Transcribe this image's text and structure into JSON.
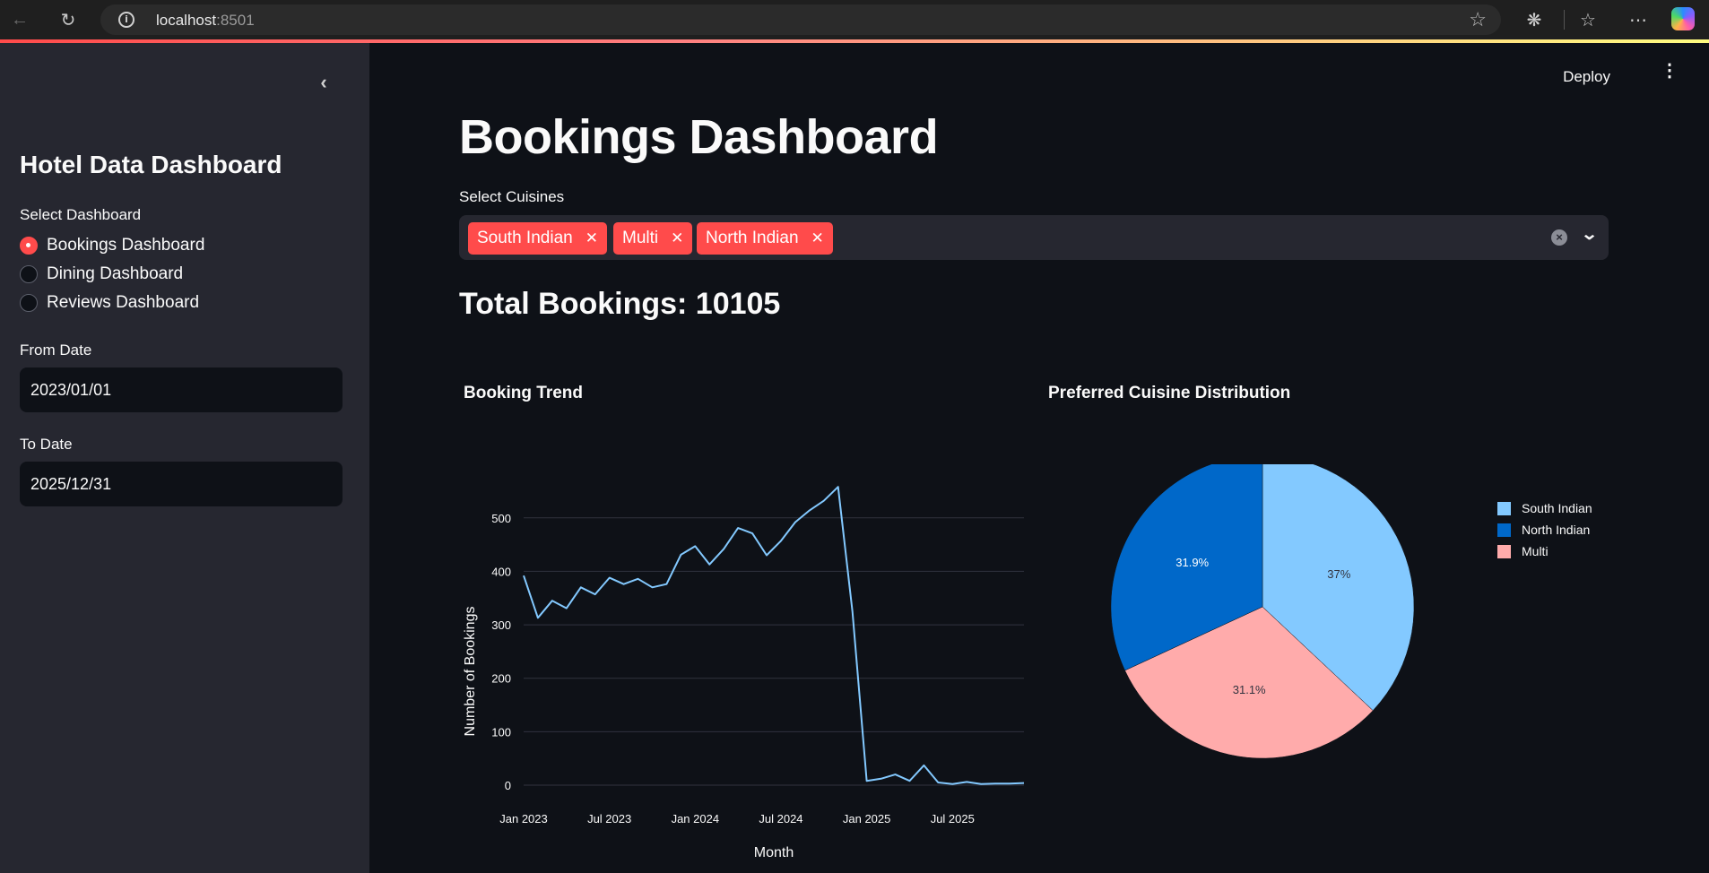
{
  "browser": {
    "url_host": "localhost",
    "url_port": ":8501"
  },
  "sidebar": {
    "title": "Hotel Data Dashboard",
    "select_label": "Select Dashboard",
    "options": [
      {
        "label": "Bookings Dashboard",
        "selected": true
      },
      {
        "label": "Dining Dashboard",
        "selected": false
      },
      {
        "label": "Reviews Dashboard",
        "selected": false
      }
    ],
    "from_label": "From Date",
    "from_value": "2023/01/01",
    "to_label": "To Date",
    "to_value": "2025/12/31"
  },
  "header": {
    "deploy_label": "Deploy"
  },
  "main": {
    "title": "Bookings Dashboard",
    "cuisines_label": "Select Cuisines",
    "selected_cuisines": [
      "South Indian",
      "Multi",
      "North Indian"
    ],
    "total_bookings": "Total Bookings: 10105",
    "trend_title": "Booking Trend",
    "pie_title": "Preferred Cuisine Distribution"
  },
  "colors": {
    "accent": "#ff4b4b",
    "line": "#83c9ff",
    "south_indian": "#83c9ff",
    "north_indian": "#0068c9",
    "multi": "#ffabab"
  },
  "chart_data": [
    {
      "type": "line",
      "title": "Booking Trend",
      "xlabel": "Month",
      "ylabel": "Number of Bookings",
      "x_ticks": [
        "Jan 2023",
        "Jul 2023",
        "Jan 2024",
        "Jul 2024",
        "Jan 2025",
        "Jul 2025"
      ],
      "y_ticks": [
        0,
        100,
        200,
        300,
        400,
        500
      ],
      "ylim": [
        0,
        560
      ],
      "grid": true,
      "x": [
        "2023-01",
        "2023-02",
        "2023-03",
        "2023-04",
        "2023-05",
        "2023-06",
        "2023-07",
        "2023-08",
        "2023-09",
        "2023-10",
        "2023-11",
        "2023-12",
        "2024-01",
        "2024-02",
        "2024-03",
        "2024-04",
        "2024-05",
        "2024-06",
        "2024-07",
        "2024-08",
        "2024-09",
        "2024-10",
        "2024-11",
        "2024-12",
        "2025-01",
        "2025-02",
        "2025-03",
        "2025-04",
        "2025-05",
        "2025-06",
        "2025-07",
        "2025-08",
        "2025-09",
        "2025-10",
        "2025-11",
        "2025-12"
      ],
      "values": [
        392,
        313,
        345,
        331,
        370,
        357,
        388,
        376,
        386,
        370,
        376,
        431,
        447,
        413,
        442,
        481,
        471,
        430,
        457,
        492,
        514,
        532,
        558,
        325,
        8,
        12,
        20,
        8,
        37,
        5,
        2,
        6,
        2,
        3,
        3,
        4
      ]
    },
    {
      "type": "pie",
      "title": "Preferred Cuisine Distribution",
      "legend": "top-right",
      "categories": [
        "South Indian",
        "North Indian",
        "Multi"
      ],
      "values": [
        37,
        31.9,
        31.1
      ],
      "labels": [
        "37%",
        "31.9%",
        "31.1%"
      ]
    }
  ]
}
